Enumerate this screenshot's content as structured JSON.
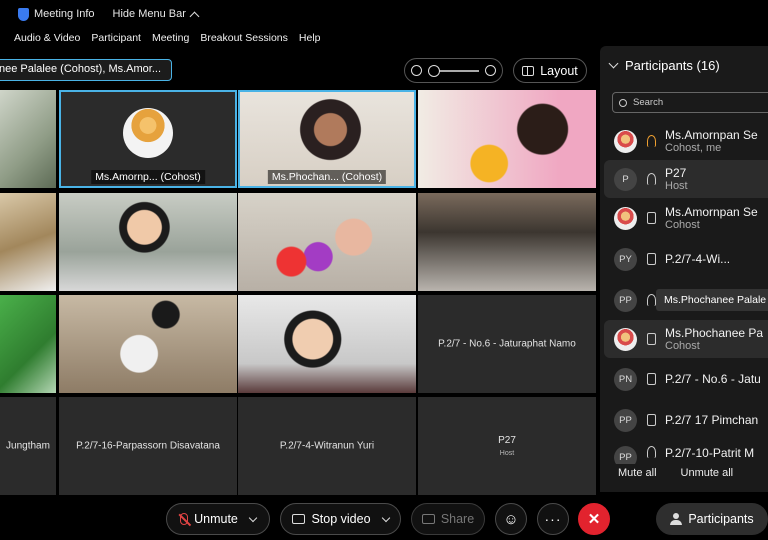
{
  "topbar": {
    "meeting_info": "Meeting Info",
    "hide_menu": "Hide Menu Bar"
  },
  "menu": [
    "Audio & Video",
    "Participant",
    "Meeting",
    "Breakout Sessions",
    "Help"
  ],
  "speaker": "nee Palalee (Cohost), Ms.Amor...",
  "layout_label": "Layout",
  "tiles": {
    "t1": "Ms.Amornp... (Cohost)",
    "t2": "Ms.Phochan... (Cohost)",
    "t3": "P.2/7 - No.6 - Jaturaphat Namo",
    "t4": "Jungtham",
    "t5": "P.2/7-16-Parpassorn Disavatana",
    "t6": "P.2/7-4-Witranun Yuri",
    "t7": "P27",
    "t7_sub": "Host"
  },
  "panel": {
    "title": "Participants (16)",
    "search_placeholder": "Search",
    "rows": [
      {
        "initials": "",
        "name": "Ms.Amornpan Se",
        "role": "Cohost, me"
      },
      {
        "initials": "P",
        "name": "P27",
        "role": "Host"
      },
      {
        "initials": "",
        "name": "Ms.Amornpan Se",
        "role": "Cohost"
      },
      {
        "initials": "PY",
        "name": "P.2/7-4-Wi...",
        "role": ""
      },
      {
        "initials": "PP",
        "name": "",
        "role": ""
      },
      {
        "initials": "",
        "name": "Ms.Phochanee Pa",
        "role": "Cohost"
      },
      {
        "initials": "PN",
        "name": "P.2/7 - No.6 - Jatu",
        "role": ""
      },
      {
        "initials": "PP",
        "name": "P.2/7 17 Pimchan",
        "role": ""
      },
      {
        "initials": "PP",
        "name": "P.2/7-10-Patrit M",
        "role": ""
      }
    ],
    "tooltip": "Ms.Phochanee Palale",
    "mute_all": "Mute all",
    "unmute_all": "Unmute all"
  },
  "toolbar": {
    "unmute": "Unmute",
    "stop_video": "Stop video",
    "share": "Share",
    "participants": "Participants"
  },
  "colors": {
    "accent": "#4ab3e6",
    "leave": "#e2232e",
    "muted": "#e24444"
  }
}
